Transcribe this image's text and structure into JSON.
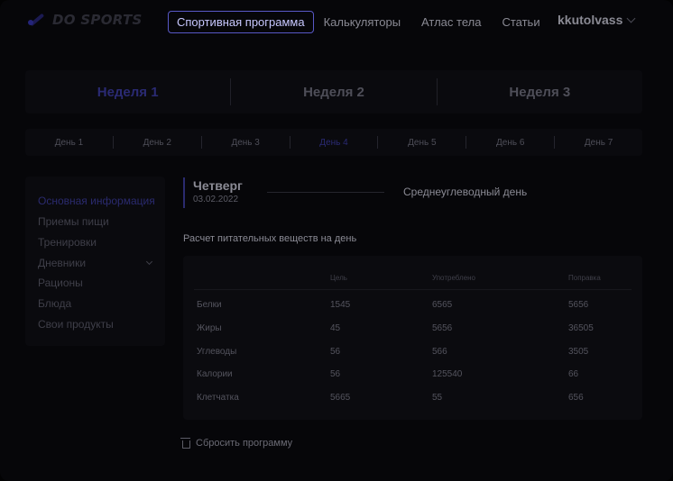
{
  "brand": {
    "name": "DO SPORTS"
  },
  "nav": {
    "items": [
      "Спортивная программа",
      "Калькуляторы",
      "Атлас тела",
      "Статьи"
    ]
  },
  "user": {
    "name": "kkutolvass"
  },
  "weeks": [
    "Неделя 1",
    "Неделя 2",
    "Неделя 3"
  ],
  "days": [
    "День 1",
    "День 2",
    "День 3",
    "День 4",
    "День 5",
    "День 6",
    "День 7"
  ],
  "sidebar": {
    "items": [
      "Основная информация",
      "Приемы пищи",
      "Тренировки",
      "Дневники",
      "Рационы",
      "Блюда",
      "Свои продукты"
    ]
  },
  "day": {
    "name": "Четверг",
    "date": "03.02.2022",
    "type": "Среднеуглеводный день"
  },
  "nutrition": {
    "title": "Расчет питательных веществ на день",
    "columns": [
      "Цель",
      "Употреблено",
      "Поправка"
    ],
    "rows": [
      {
        "label": "Белки",
        "goal": "1545",
        "consumed": "6565",
        "correction": "5656"
      },
      {
        "label": "Жиры",
        "goal": "45",
        "consumed": "5656",
        "correction": "36505"
      },
      {
        "label": "Углеводы",
        "goal": "56",
        "consumed": "566",
        "correction": "3505"
      },
      {
        "label": "Калории",
        "goal": "56",
        "consumed": "125540",
        "correction": "66"
      },
      {
        "label": "Клетчатка",
        "goal": "5665",
        "consumed": "55",
        "correction": "656"
      }
    ]
  },
  "actions": {
    "reset_label": "Сбросить программу"
  },
  "colors": {
    "accent": "#5858c6",
    "active_dark": "#2a2a6e",
    "background": "#060609"
  }
}
